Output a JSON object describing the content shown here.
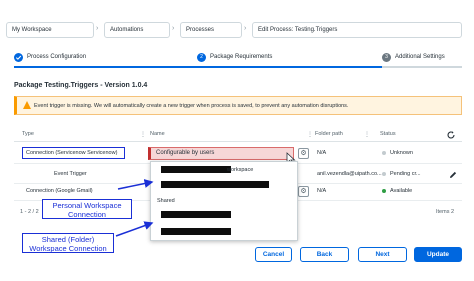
{
  "breadcrumb": {
    "items": [
      "My Workspace",
      "Automations",
      "Processes",
      "Edit Process: Testing.Triggers"
    ],
    "separator": "›"
  },
  "stepper": {
    "steps": [
      {
        "number": "1",
        "label": "Process Configuration",
        "state": "done"
      },
      {
        "number": "2",
        "label": "Package Requirements",
        "state": "active"
      },
      {
        "number": "3",
        "label": "Additional Settings",
        "state": "pending"
      }
    ]
  },
  "package_title": "Package Testing.Triggers - Version 1.0.4",
  "banner": {
    "text": "Event trigger is missing. We will automatically create a new trigger when process is saved, to prevent any automation disruptions."
  },
  "table": {
    "columns": [
      "Type",
      "Name",
      "Folder path",
      "Status"
    ],
    "rows": [
      {
        "type": "Connection (Servicenow Servicenow)",
        "name": "Configurable by users",
        "folder": "N/A",
        "status": "Unknown",
        "status_color": "#c3cbcf"
      },
      {
        "type": "Event Trigger",
        "name": "",
        "folder": "anil.vezendla@uipath.co...",
        "status": "Pending cr...",
        "status_color": "#c3cbcf"
      },
      {
        "type": "Connection (Google Gmail)",
        "name": "",
        "folder": "N/A",
        "status": "Available",
        "status_color": "#2f9e44"
      }
    ],
    "pagination_range": "1 - 2 / 2",
    "items_label": "Items 2"
  },
  "dropdown": {
    "workspace_suffix": "workspace",
    "shared_header": "Shared"
  },
  "annotations": {
    "personal": "Personal Workspace Connection",
    "shared": "Shared (Folder) Workspace Connection"
  },
  "footer": {
    "cancel": "Cancel",
    "back": "Back",
    "next": "Next",
    "update": "Update"
  },
  "colors": {
    "accent": "#0067df",
    "warning": "#fa9b00",
    "annotation": "#1a2fd6",
    "error": "#c12f2f"
  },
  "icons": [
    "check-icon",
    "warning-icon",
    "refresh-icon",
    "settings-icon",
    "edit-icon",
    "filter-icon",
    "cursor-icon"
  ]
}
